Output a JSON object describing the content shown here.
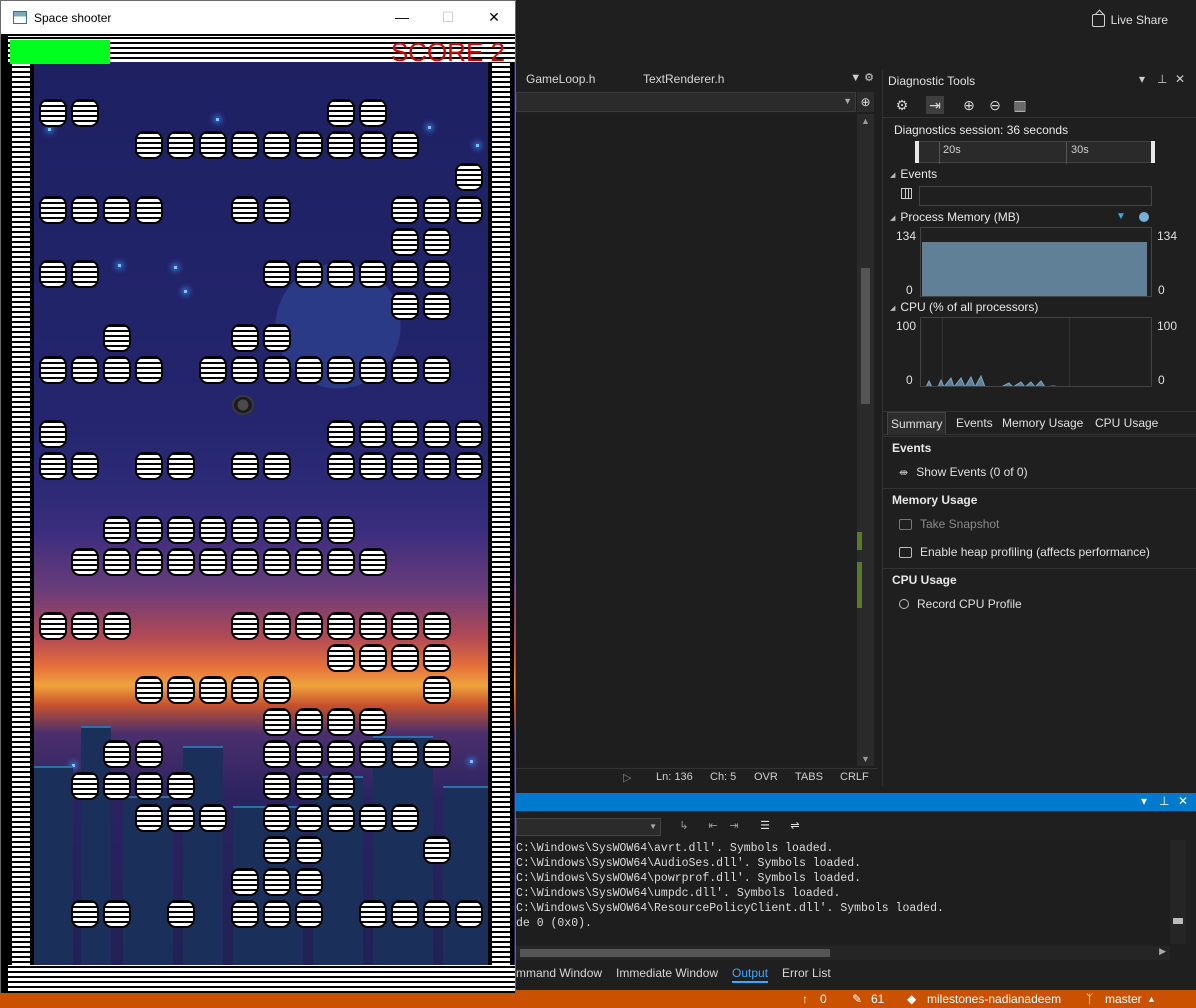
{
  "game_window": {
    "title": "Space shooter",
    "minimize": "—",
    "maximize": "☐",
    "close": "✕",
    "score_text": "SCORE 2",
    "health_fraction": 1.0,
    "colors": {
      "health": "#00ff1e",
      "score": "#d40000"
    }
  },
  "header": {
    "live_share": "Live Share"
  },
  "doc_tabs": [
    "GameLoop.h",
    "TextRenderer.h"
  ],
  "editor_status": {
    "line": "Ln: 136",
    "col": "Ch: 5",
    "ovr": "OVR",
    "tabs": "TABS",
    "eol": "CRLF"
  },
  "diagnostic": {
    "title": "Diagnostic Tools",
    "session": "Diagnostics session: 36 seconds",
    "timeline_labels": [
      "20s",
      "30s"
    ],
    "events_label": "Events",
    "memory_label": "Process Memory (MB)",
    "memory_max": "134",
    "memory_min": "0",
    "cpu_label": "CPU (% of all processors)",
    "cpu_max": "100",
    "cpu_min": "0",
    "tabs": [
      "Summary",
      "Events",
      "Memory Usage",
      "CPU Usage"
    ],
    "groups": {
      "events": {
        "title": "Events",
        "item": "Show Events (0 of 0)"
      },
      "memory": {
        "title": "Memory Usage",
        "snapshot": "Take Snapshot",
        "heap": "Enable heap profiling (affects performance)"
      },
      "cpu": {
        "title": "CPU Usage",
        "record": "Record CPU Profile"
      }
    }
  },
  "output": {
    "lines": [
      "C:\\Windows\\SysWOW64\\avrt.dll'. Symbols loaded.",
      "C:\\Windows\\SysWOW64\\AudioSes.dll'. Symbols loaded.",
      "C:\\Windows\\SysWOW64\\powrprof.dll'. Symbols loaded.",
      "C:\\Windows\\SysWOW64\\umpdc.dll'. Symbols loaded.",
      "C:\\Windows\\SysWOW64\\ResourcePolicyClient.dll'. Symbols loaded.",
      "de 0 (0x0)."
    ]
  },
  "bottom_tabs": [
    "mmand Window",
    "Immediate Window",
    "Output",
    "Error List"
  ],
  "statusbar": {
    "up": "0",
    "edits": "61",
    "repo": "milestones-nadianadeem",
    "branch": "master"
  }
}
